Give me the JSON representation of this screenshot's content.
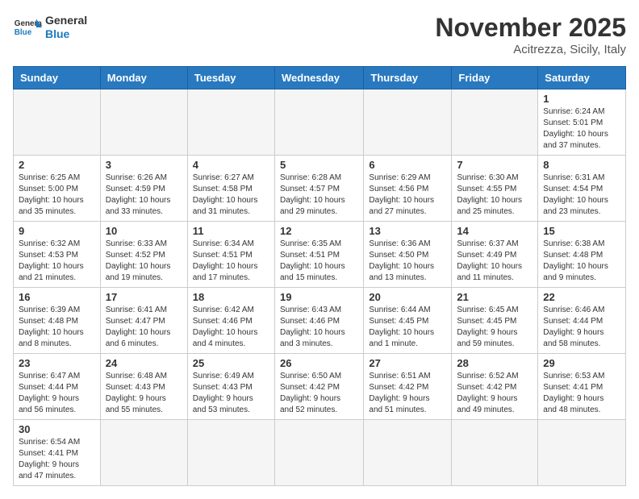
{
  "header": {
    "logo_general": "General",
    "logo_blue": "Blue",
    "month_title": "November 2025",
    "location": "Acitrezza, Sicily, Italy"
  },
  "weekdays": [
    "Sunday",
    "Monday",
    "Tuesday",
    "Wednesday",
    "Thursday",
    "Friday",
    "Saturday"
  ],
  "weeks": [
    [
      {
        "day": "",
        "info": ""
      },
      {
        "day": "",
        "info": ""
      },
      {
        "day": "",
        "info": ""
      },
      {
        "day": "",
        "info": ""
      },
      {
        "day": "",
        "info": ""
      },
      {
        "day": "",
        "info": ""
      },
      {
        "day": "1",
        "info": "Sunrise: 6:24 AM\nSunset: 5:01 PM\nDaylight: 10 hours\nand 37 minutes."
      }
    ],
    [
      {
        "day": "2",
        "info": "Sunrise: 6:25 AM\nSunset: 5:00 PM\nDaylight: 10 hours\nand 35 minutes."
      },
      {
        "day": "3",
        "info": "Sunrise: 6:26 AM\nSunset: 4:59 PM\nDaylight: 10 hours\nand 33 minutes."
      },
      {
        "day": "4",
        "info": "Sunrise: 6:27 AM\nSunset: 4:58 PM\nDaylight: 10 hours\nand 31 minutes."
      },
      {
        "day": "5",
        "info": "Sunrise: 6:28 AM\nSunset: 4:57 PM\nDaylight: 10 hours\nand 29 minutes."
      },
      {
        "day": "6",
        "info": "Sunrise: 6:29 AM\nSunset: 4:56 PM\nDaylight: 10 hours\nand 27 minutes."
      },
      {
        "day": "7",
        "info": "Sunrise: 6:30 AM\nSunset: 4:55 PM\nDaylight: 10 hours\nand 25 minutes."
      },
      {
        "day": "8",
        "info": "Sunrise: 6:31 AM\nSunset: 4:54 PM\nDaylight: 10 hours\nand 23 minutes."
      }
    ],
    [
      {
        "day": "9",
        "info": "Sunrise: 6:32 AM\nSunset: 4:53 PM\nDaylight: 10 hours\nand 21 minutes."
      },
      {
        "day": "10",
        "info": "Sunrise: 6:33 AM\nSunset: 4:52 PM\nDaylight: 10 hours\nand 19 minutes."
      },
      {
        "day": "11",
        "info": "Sunrise: 6:34 AM\nSunset: 4:51 PM\nDaylight: 10 hours\nand 17 minutes."
      },
      {
        "day": "12",
        "info": "Sunrise: 6:35 AM\nSunset: 4:51 PM\nDaylight: 10 hours\nand 15 minutes."
      },
      {
        "day": "13",
        "info": "Sunrise: 6:36 AM\nSunset: 4:50 PM\nDaylight: 10 hours\nand 13 minutes."
      },
      {
        "day": "14",
        "info": "Sunrise: 6:37 AM\nSunset: 4:49 PM\nDaylight: 10 hours\nand 11 minutes."
      },
      {
        "day": "15",
        "info": "Sunrise: 6:38 AM\nSunset: 4:48 PM\nDaylight: 10 hours\nand 9 minutes."
      }
    ],
    [
      {
        "day": "16",
        "info": "Sunrise: 6:39 AM\nSunset: 4:48 PM\nDaylight: 10 hours\nand 8 minutes."
      },
      {
        "day": "17",
        "info": "Sunrise: 6:41 AM\nSunset: 4:47 PM\nDaylight: 10 hours\nand 6 minutes."
      },
      {
        "day": "18",
        "info": "Sunrise: 6:42 AM\nSunset: 4:46 PM\nDaylight: 10 hours\nand 4 minutes."
      },
      {
        "day": "19",
        "info": "Sunrise: 6:43 AM\nSunset: 4:46 PM\nDaylight: 10 hours\nand 3 minutes."
      },
      {
        "day": "20",
        "info": "Sunrise: 6:44 AM\nSunset: 4:45 PM\nDaylight: 10 hours\nand 1 minute."
      },
      {
        "day": "21",
        "info": "Sunrise: 6:45 AM\nSunset: 4:45 PM\nDaylight: 9 hours\nand 59 minutes."
      },
      {
        "day": "22",
        "info": "Sunrise: 6:46 AM\nSunset: 4:44 PM\nDaylight: 9 hours\nand 58 minutes."
      }
    ],
    [
      {
        "day": "23",
        "info": "Sunrise: 6:47 AM\nSunset: 4:44 PM\nDaylight: 9 hours\nand 56 minutes."
      },
      {
        "day": "24",
        "info": "Sunrise: 6:48 AM\nSunset: 4:43 PM\nDaylight: 9 hours\nand 55 minutes."
      },
      {
        "day": "25",
        "info": "Sunrise: 6:49 AM\nSunset: 4:43 PM\nDaylight: 9 hours\nand 53 minutes."
      },
      {
        "day": "26",
        "info": "Sunrise: 6:50 AM\nSunset: 4:42 PM\nDaylight: 9 hours\nand 52 minutes."
      },
      {
        "day": "27",
        "info": "Sunrise: 6:51 AM\nSunset: 4:42 PM\nDaylight: 9 hours\nand 51 minutes."
      },
      {
        "day": "28",
        "info": "Sunrise: 6:52 AM\nSunset: 4:42 PM\nDaylight: 9 hours\nand 49 minutes."
      },
      {
        "day": "29",
        "info": "Sunrise: 6:53 AM\nSunset: 4:41 PM\nDaylight: 9 hours\nand 48 minutes."
      }
    ],
    [
      {
        "day": "30",
        "info": "Sunrise: 6:54 AM\nSunset: 4:41 PM\nDaylight: 9 hours\nand 47 minutes."
      },
      {
        "day": "",
        "info": ""
      },
      {
        "day": "",
        "info": ""
      },
      {
        "day": "",
        "info": ""
      },
      {
        "day": "",
        "info": ""
      },
      {
        "day": "",
        "info": ""
      },
      {
        "day": "",
        "info": ""
      }
    ]
  ]
}
